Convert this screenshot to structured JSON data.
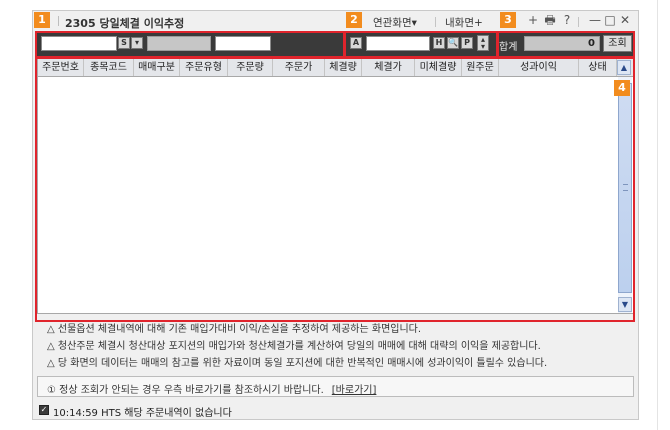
{
  "window": {
    "title": "2305 당일체결 이익추정",
    "menu_related": "연관화면",
    "menu_related_arrow": "▾",
    "menu_my_screen": "내화면",
    "menu_my_screen_plus": "+",
    "sys_add": "+",
    "sys_print": "🖶",
    "sys_help": "?",
    "sys_minimize": "—",
    "sys_maximize": "□",
    "sys_close": "✕"
  },
  "toolbar": {
    "account_input": "",
    "s_button": "S",
    "dropdown_arrow": "▾",
    "account_name": "",
    "password": "",
    "a_button": "A",
    "code_input": "",
    "h_button": "H",
    "search_icon": "🔍",
    "p_button": "P",
    "spin_up": "▴",
    "spin_down": "▾",
    "total_label": "합계",
    "total_value": "0",
    "query_button": "조회"
  },
  "grid": {
    "columns": [
      "주문번호",
      "종목코드",
      "매매구분",
      "주문유형",
      "주문량",
      "주문가",
      "체결량",
      "체결가",
      "미체결량",
      "원주문",
      "성과이익",
      "상태"
    ],
    "scroll_up": "▲",
    "scroll_down": "▼"
  },
  "notes": [
    "△ 선물옵션 체결내역에 대해 기존 매입가대비 이익/손실을 추정하여 제공하는 화면입니다.",
    "△ 청산주문 체결시 청산대상 포지션의 매입가와 청산체결가를 계산하여 당일의 매매에 대해 대략의 이익을 제공합니다.",
    "△ 당 화면의 데이터는 매매의 참고를 위한 자료이며 동일 포지션에 대한 반복적인 매매시에  성과이익이 틀릴수 있습니다."
  ],
  "info": {
    "text": "① 정상 조회가 안되는 경우 우측 바로가기를 참조하시기 바랍니다.",
    "link": "[바로가기]"
  },
  "status": {
    "check": "✓",
    "text": "10:14:59  HTS 해당 주문내역이 없습니다"
  },
  "badges": [
    "1",
    "2",
    "3",
    "4"
  ],
  "colors": {
    "badge": "#f28c1e",
    "highlight": "#e0242c",
    "toolbar_bg": "#3a3a3a"
  }
}
